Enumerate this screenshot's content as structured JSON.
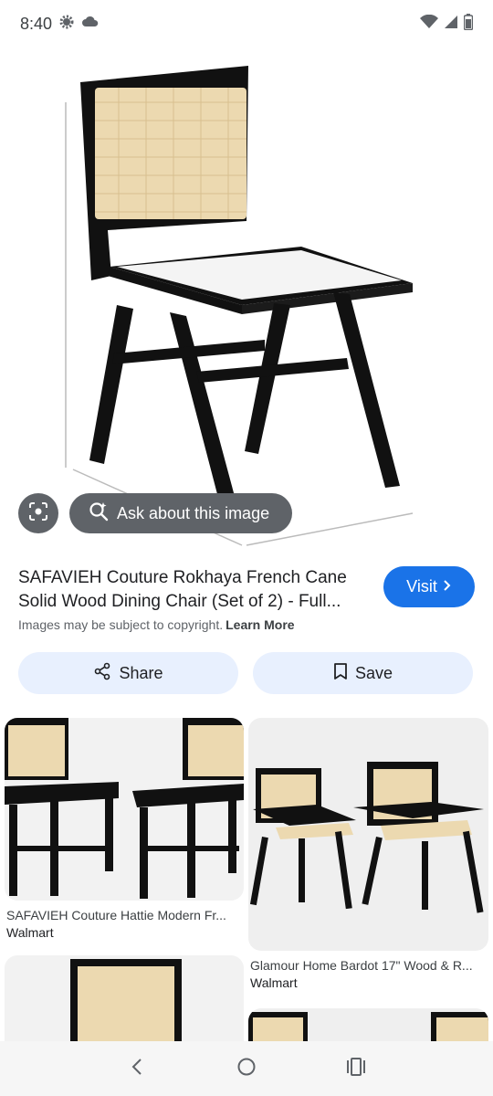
{
  "status_bar": {
    "time": "8:40",
    "icons": [
      "settings-gear-icon",
      "cloud-icon",
      "wifi-icon",
      "signal-icon",
      "battery-icon"
    ]
  },
  "hero": {
    "lens_icon": "lens-icon",
    "ask_label": "Ask about this image"
  },
  "result": {
    "title": "SAFAVIEH Couture Rokhaya French Cane Solid Wood Dining Chair (Set of 2) - Full...",
    "visit_label": "Visit",
    "copyright_text": "Images may be subject to copyright.",
    "learn_more": "Learn More"
  },
  "actions": {
    "share_label": "Share",
    "save_label": "Save"
  },
  "related": [
    {
      "title": "SAFAVIEH Couture Hattie Modern Fr...",
      "source": "Walmart"
    },
    {
      "title": "Glamour Home Bardot 17\" Wood & R...",
      "source": "Walmart"
    }
  ],
  "colors": {
    "accent": "#1a73e8",
    "button_bg": "#e8f0fe",
    "overlay": "#5f6368"
  }
}
